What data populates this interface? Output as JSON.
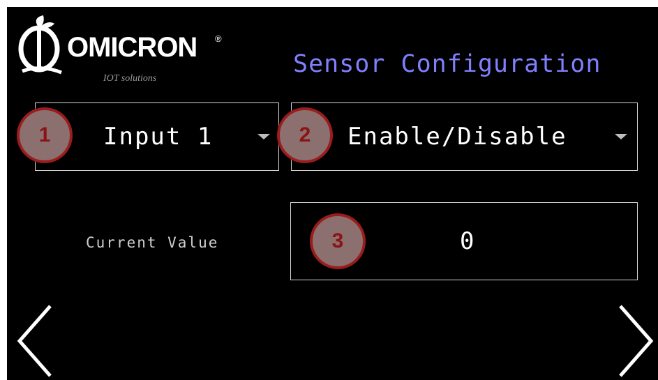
{
  "brand": {
    "name": "OMICRON",
    "registered": "®",
    "tagline": "IOT solutions"
  },
  "screen": {
    "title": "Sensor Configuration"
  },
  "input_select": {
    "selected": "Input 1"
  },
  "mode_select": {
    "selected": "Enable/Disable"
  },
  "current_value": {
    "label": "Current Value",
    "value": "0"
  },
  "callouts": [
    "1",
    "2",
    "3"
  ],
  "colors": {
    "background": "#000000",
    "title": "#8080ff",
    "callout_fill": "#8c6f6f",
    "callout_border": "#9b1c1c"
  },
  "icons": {
    "prev": "chevron-left-icon",
    "next": "chevron-right-icon",
    "dropdown": "caret-down-icon"
  }
}
